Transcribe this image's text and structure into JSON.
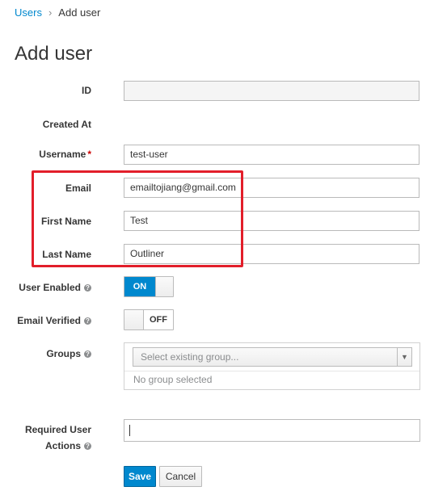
{
  "breadcrumb": {
    "parent": "Users",
    "separator": "›",
    "current": "Add user"
  },
  "page": {
    "title": "Add user"
  },
  "form": {
    "id": {
      "label": "ID",
      "value": ""
    },
    "created_at": {
      "label": "Created At",
      "value": ""
    },
    "username": {
      "label": "Username",
      "required_mark": "*",
      "value": "test-user"
    },
    "email": {
      "label": "Email",
      "value": "emailtojiang@gmail.com"
    },
    "first_name": {
      "label": "First Name",
      "value": "Test"
    },
    "last_name": {
      "label": "Last Name",
      "value": "Outliner"
    },
    "user_enabled": {
      "label": "User Enabled",
      "state": "ON"
    },
    "email_verified": {
      "label": "Email Verified",
      "state": "OFF"
    },
    "groups": {
      "label": "Groups",
      "placeholder": "Select existing group...",
      "empty_text": "No group selected"
    },
    "required_actions": {
      "label_line1": "Required User",
      "label_line2": "Actions",
      "value": ""
    }
  },
  "buttons": {
    "save": "Save",
    "cancel": "Cancel"
  },
  "icons": {
    "help": "help-circle-icon",
    "dropdown": "caret-down-icon"
  },
  "colors": {
    "accent": "#0088ce",
    "highlight": "#e21e2a",
    "required": "#cc0000"
  }
}
